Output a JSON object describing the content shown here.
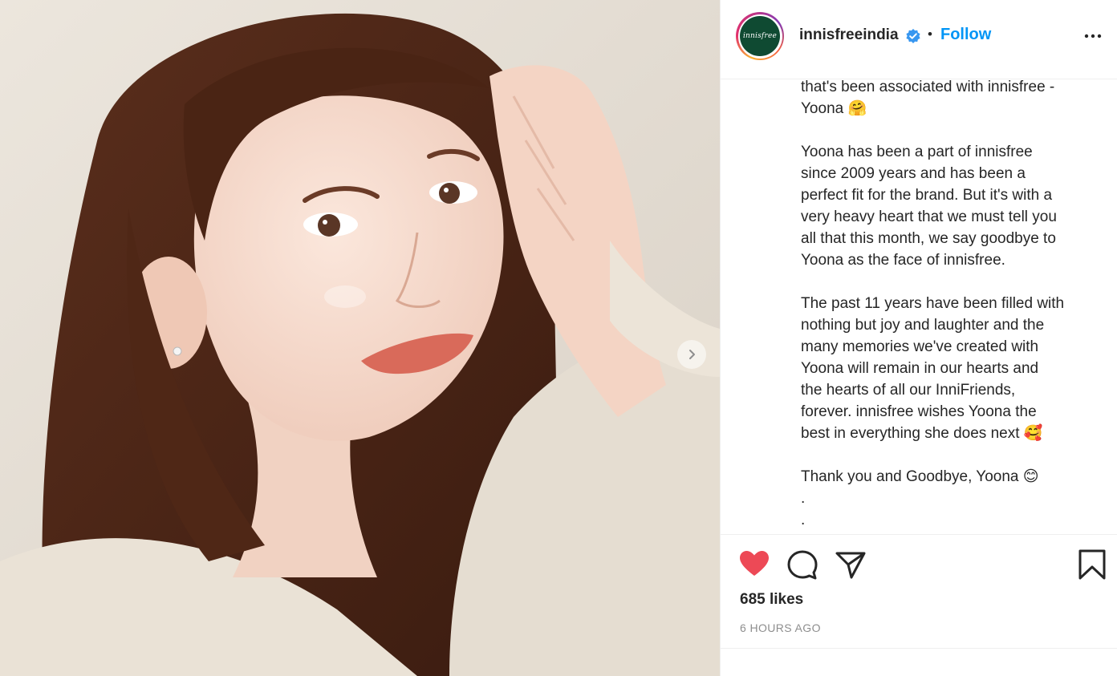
{
  "post": {
    "image_alt": "Portrait of a smiling woman with long brown hair resting her hand near her head",
    "next_icon": "chevron-right-icon"
  },
  "header": {
    "avatar_text": "innisfree",
    "username": "innisfreeindia",
    "verified_icon": "verified-badge-icon",
    "separator": "•",
    "follow_label": "Follow",
    "more_icon": "more-options-icon"
  },
  "caption": {
    "lines": [
      "that's been associated with innisfree -",
      "Yoona 🤗",
      "",
      "Yoona has been a part of innisfree",
      "since 2009 years and has been a",
      "perfect fit for the brand. But it's with a",
      "very heavy heart that we must tell you",
      "all that this month, we say goodbye to",
      "Yoona as the face of innisfree.",
      "",
      "The past 11 years have been filled with",
      "nothing but joy and laughter and the",
      "many memories we've created with",
      "Yoona will remain in our hearts and",
      "the hearts of all our InniFriends,",
      "forever. innisfree wishes Yoona the",
      "best in everything she does next 🥰",
      "",
      "Thank you and Goodbye, Yoona 😊",
      ".",
      "."
    ]
  },
  "actions": {
    "like_icon": "heart-filled-icon",
    "comment_icon": "comment-icon",
    "share_icon": "share-icon",
    "save_icon": "bookmark-icon",
    "like_color": "#ed4956"
  },
  "stats": {
    "likes": "685 likes",
    "timestamp": "6 HOURS AGO"
  },
  "colors": {
    "link": "#0095f6",
    "text": "#262626",
    "muted": "#8e8e8e",
    "divider": "#efefef"
  }
}
